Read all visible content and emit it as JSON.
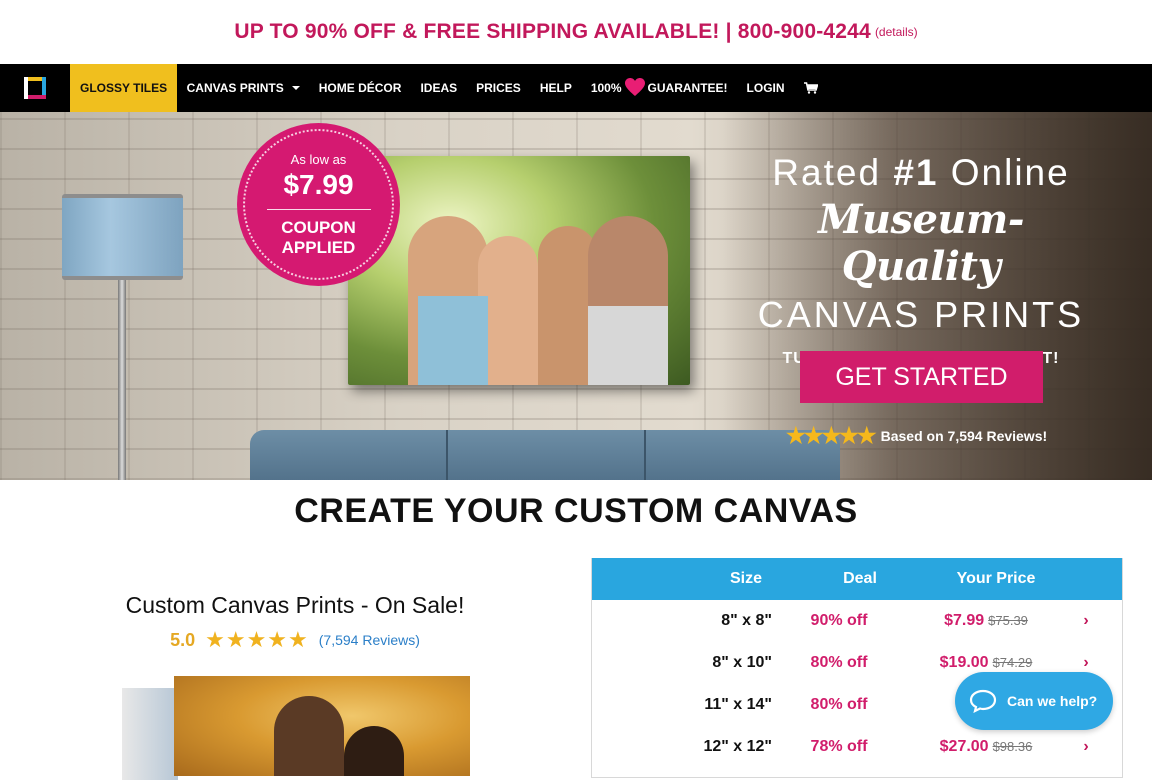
{
  "promo": {
    "text": "UP TO 90% OFF & FREE SHIPPING AVAILABLE! | 800-900-4244",
    "details": "(details)"
  },
  "nav": {
    "logo_icon": "square-logo-icon",
    "items": [
      {
        "label": "GLOSSY TILES"
      },
      {
        "label": "CANVAS PRINTS"
      },
      {
        "label": "HOME DÉCOR"
      },
      {
        "label": "IDEAS"
      },
      {
        "label": "PRICES"
      },
      {
        "label": "HELP"
      },
      {
        "label_pre": "100%",
        "label_post": "GUARANTEE!"
      },
      {
        "label": "LOGIN"
      }
    ],
    "cart_icon": "cart-icon",
    "active_color": "#f0bf1e"
  },
  "hero": {
    "badge": {
      "low": "As low as",
      "price": "$7.99",
      "coupon_line1": "COUPON",
      "coupon_line2": "APPLIED"
    },
    "rated_pre": "Rated ",
    "rated_bold": "#1",
    "rated_post": " Online",
    "museum": "Museum-Quality",
    "canvas": "CANVAS PRINTS",
    "turn": "TURN YOUR PHOTOS INTO ART!",
    "cta": "GET STARTED",
    "stars": "★★★★★",
    "reviews": "Based on 7,594 Reviews!"
  },
  "create": {
    "title": "CREATE YOUR CUSTOM CANVAS"
  },
  "product": {
    "title": "Custom Canvas Prints - On Sale!",
    "rating": "5.0",
    "stars": "★★★★★",
    "reviews": "(7,594 Reviews)"
  },
  "price_table": {
    "headers": {
      "size": "Size",
      "deal": "Deal",
      "price": "Your Price"
    },
    "rows": [
      {
        "size": "8\" x 8\"",
        "deal": "90% off",
        "price": "$7.99",
        "old": "$75.39"
      },
      {
        "size": "8\" x 10\"",
        "deal": "80% off",
        "price": "$19.00",
        "old": "$74.29"
      },
      {
        "size": "11\" x 14\"",
        "deal": "80% off",
        "price": "$2",
        "old": ""
      },
      {
        "size": "12\" x 12\"",
        "deal": "78% off",
        "price": "$27.00",
        "old": "$98.36"
      }
    ]
  },
  "chat": {
    "label": "Can we help?"
  },
  "colors": {
    "brand_pink": "#d11d6b",
    "table_header": "#29a6df",
    "star_gold": "#f0b21f"
  }
}
